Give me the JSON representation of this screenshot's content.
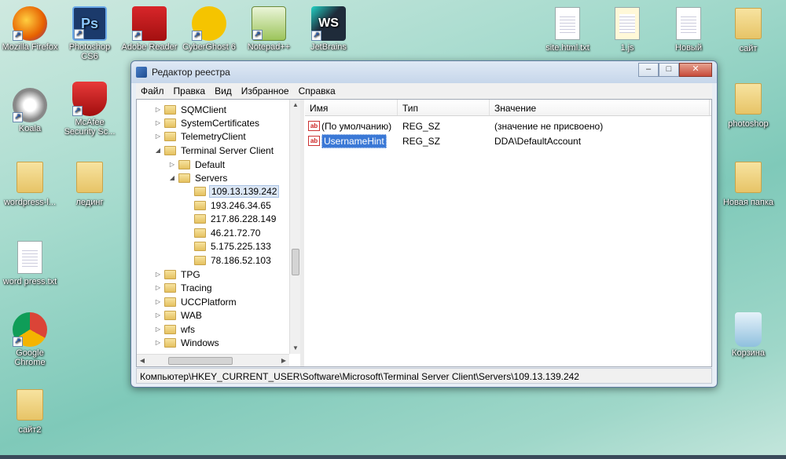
{
  "desktop": {
    "icons": [
      {
        "label": "Mozilla Firefox",
        "icon": "firefox-icon",
        "color": "#e66000"
      },
      {
        "label": "Photoshop CS6",
        "icon": "photoshop-icon",
        "color": "#1b3a6b",
        "glyph": "Ps"
      },
      {
        "label": "Adobe Reader",
        "icon": "adobe-reader-icon",
        "color": "#c31b1b"
      },
      {
        "label": "CyberGhost 6",
        "icon": "cyberghost-icon",
        "color": "#f5c400"
      },
      {
        "label": "Notepad++",
        "icon": "notepad-plus-plus-icon",
        "color": "#9cc45a"
      },
      {
        "label": "JetBrains",
        "icon": "jetbrains-webstorm-icon",
        "color": "#1f2b3a",
        "glyph": "WS"
      },
      {
        "label": "site.html.txt",
        "icon": "text-file-icon"
      },
      {
        "label": "1.js",
        "icon": "script-file-icon"
      },
      {
        "label": "Новый",
        "icon": "text-file-icon"
      },
      {
        "label": "сайт",
        "icon": "folder-icon"
      },
      {
        "label": "Koala",
        "icon": "koala-icon",
        "color": "#777777"
      },
      {
        "label": "McAfee Security Sc...",
        "icon": "mcafee-icon",
        "color": "#c01818"
      },
      {
        "label": "photoshop",
        "icon": "folder-icon"
      },
      {
        "label": "wordpress-l...",
        "icon": "folder-icon"
      },
      {
        "label": "лединг",
        "icon": "folder-icon"
      },
      {
        "label": "Новая папка",
        "icon": "folder-icon"
      },
      {
        "label": "word press.txt",
        "icon": "text-file-icon"
      },
      {
        "label": "Google Chrome",
        "icon": "chrome-icon",
        "color": "#2a8a3a"
      },
      {
        "label": "Корзина",
        "icon": "recycle-bin-icon",
        "color": "#5aa0c8"
      },
      {
        "label": "сайт2",
        "icon": "folder-icon"
      }
    ]
  },
  "window": {
    "title": "Редактор реестра",
    "minimize": "–",
    "maximize": "□",
    "close": "✕",
    "menu": [
      "Файл",
      "Правка",
      "Вид",
      "Избранное",
      "Справка"
    ]
  },
  "tree": {
    "nodes": [
      {
        "label": "SQMClient",
        "expander": "▷"
      },
      {
        "label": "SystemCertificates",
        "expander": "▷"
      },
      {
        "label": "TelemetryClient",
        "expander": "▷"
      },
      {
        "label": "Terminal Server Client",
        "expander": "◢"
      },
      {
        "label": "Default",
        "expander": "▷"
      },
      {
        "label": "Servers",
        "expander": "◢"
      },
      {
        "label": "109.13.139.242",
        "expander": ""
      },
      {
        "label": "193.246.34.65",
        "expander": ""
      },
      {
        "label": "217.86.228.149",
        "expander": ""
      },
      {
        "label": "46.21.72.70",
        "expander": ""
      },
      {
        "label": "5.175.225.133",
        "expander": ""
      },
      {
        "label": "78.186.52.103",
        "expander": ""
      },
      {
        "label": "TPG",
        "expander": "▷"
      },
      {
        "label": "Tracing",
        "expander": "▷"
      },
      {
        "label": "UCCPlatform",
        "expander": "▷"
      },
      {
        "label": "WAB",
        "expander": "▷"
      },
      {
        "label": "wfs",
        "expander": "▷"
      },
      {
        "label": "Windows",
        "expander": "▷"
      }
    ]
  },
  "values": {
    "columns": [
      "Имя",
      "Тип",
      "Значение"
    ],
    "rows": [
      {
        "name": "(По умолчанию)",
        "type": "REG_SZ",
        "data": "(значение не присвоено)"
      },
      {
        "name": "UsernameHint",
        "type": "REG_SZ",
        "data": "DDA\\DefaultAccount"
      }
    ]
  },
  "status": {
    "path": "Компьютер\\HKEY_CURRENT_USER\\Software\\Microsoft\\Terminal Server Client\\Servers\\109.13.139.242"
  }
}
